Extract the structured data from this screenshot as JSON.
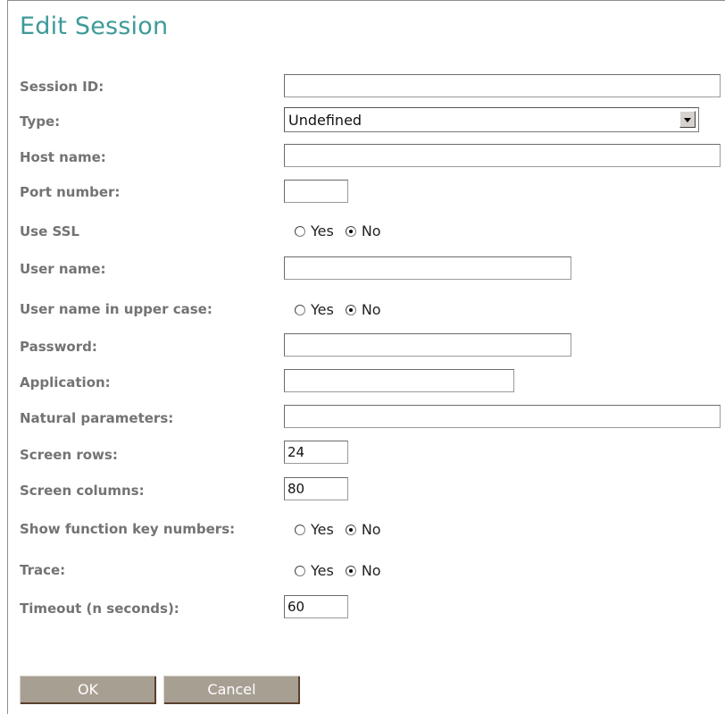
{
  "page": {
    "title": "Edit Session"
  },
  "fields": {
    "session_id": {
      "label": "Session ID:",
      "value": ""
    },
    "type": {
      "label": "Type:",
      "value": "Undefined"
    },
    "host_name": {
      "label": "Host name:",
      "value": ""
    },
    "port_number": {
      "label": "Port number:",
      "value": ""
    },
    "use_ssl": {
      "label": "Use SSL",
      "yes": "Yes",
      "no": "No",
      "selected": "No"
    },
    "user_name": {
      "label": "User name:",
      "value": ""
    },
    "user_name_upper": {
      "label": "User name in upper case:",
      "yes": "Yes",
      "no": "No",
      "selected": "No"
    },
    "password": {
      "label": "Password:",
      "value": ""
    },
    "application": {
      "label": "Application:",
      "value": ""
    },
    "natural_parameters": {
      "label": "Natural parameters:",
      "value": ""
    },
    "screen_rows": {
      "label": "Screen rows:",
      "value": "24"
    },
    "screen_columns": {
      "label": "Screen columns:",
      "value": "80"
    },
    "show_function_keys": {
      "label": "Show function key numbers:",
      "yes": "Yes",
      "no": "No",
      "selected": "No"
    },
    "trace": {
      "label": "Trace:",
      "yes": "Yes",
      "no": "No",
      "selected": "No"
    },
    "timeout": {
      "label": "Timeout (n seconds):",
      "value": "60"
    }
  },
  "buttons": {
    "ok": "OK",
    "cancel": "Cancel"
  },
  "colors": {
    "title": "#3e9a98",
    "label": "#737373",
    "button": "#a89f93"
  }
}
